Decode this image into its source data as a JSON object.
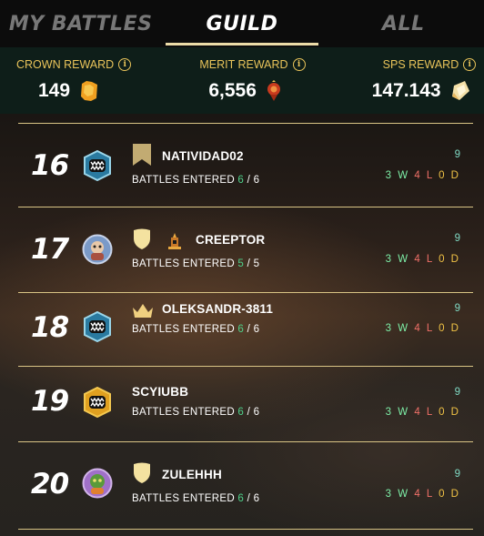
{
  "tabs": [
    {
      "label": "MY BATTLES",
      "active": false
    },
    {
      "label": "GUILD",
      "active": true
    },
    {
      "label": "ALL",
      "active": false
    }
  ],
  "rewards": {
    "crown": {
      "label": "CROWN REWARD",
      "value": "149",
      "icon": "crown-token-icon"
    },
    "merit": {
      "label": "MERIT REWARD",
      "value": "6,556",
      "icon": "merit-gem-icon"
    },
    "sps": {
      "label": "SPS REWARD",
      "value": "147.143",
      "icon": "sps-token-icon"
    }
  },
  "rows": [
    {
      "rank": "16",
      "name": "NATIVIDAD02",
      "league": "banner-icon",
      "avatar": "monster-avatar",
      "entered_label": "BATTLES ENTERED",
      "entered": "6",
      "total": "6",
      "score": "9",
      "w": "3 W",
      "l": "4 L",
      "d": "0 D"
    },
    {
      "rank": "17",
      "name": "CREEPTOR",
      "league": "shield-icon",
      "avatar": "character-avatar",
      "entered_label": "BATTLES ENTERED",
      "entered": "5",
      "total": "5",
      "score": "9",
      "w": "3 W",
      "l": "4 L",
      "d": "0 D"
    },
    {
      "rank": "18",
      "name": "OLEKSANDR-3811",
      "league": "crown-icon",
      "avatar": "monster-avatar",
      "entered_label": "BATTLES ENTERED",
      "entered": "6",
      "total": "6",
      "score": "9",
      "w": "3 W",
      "l": "4 L",
      "d": "0 D"
    },
    {
      "rank": "19",
      "name": "SCYIUBB",
      "league": "",
      "avatar": "gold-monster-avatar",
      "entered_label": "BATTLES ENTERED",
      "entered": "6",
      "total": "6",
      "score": "9",
      "w": "3 W",
      "l": "4 L",
      "d": "0 D"
    },
    {
      "rank": "20",
      "name": "ZULEHHH",
      "league": "shield-icon",
      "avatar": "character-avatar",
      "entered_label": "BATTLES ENTERED",
      "entered": "6",
      "total": "6",
      "score": "9",
      "w": "3 W",
      "l": "4 L",
      "d": "0 D"
    }
  ],
  "colors": {
    "accent": "#ecdca8",
    "gold_label": "#e9c45a",
    "win": "#7ef0a8",
    "loss": "#f07068",
    "draw": "#f0c245"
  }
}
